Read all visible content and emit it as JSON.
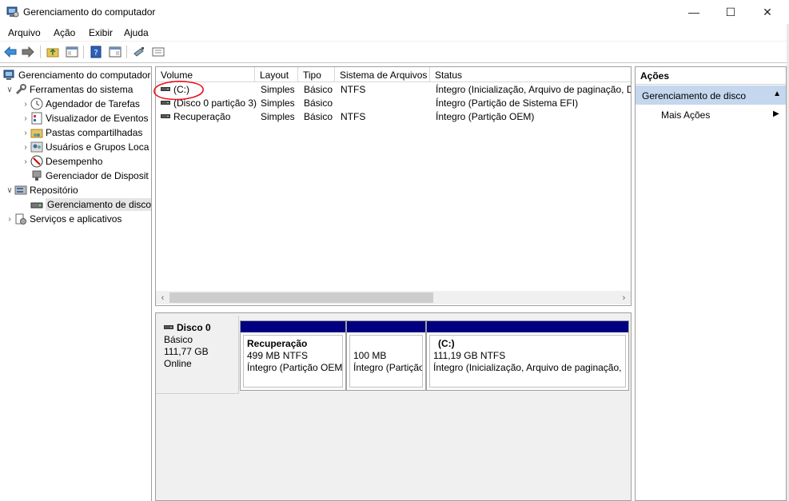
{
  "window": {
    "title": "Gerenciamento do computador",
    "min_glyph": "—",
    "max_glyph": "☐",
    "close_glyph": "✕"
  },
  "menu": [
    "Arquivo",
    "Ação",
    "Exibir",
    "Ajuda"
  ],
  "tree": {
    "root": "Gerenciamento do computador",
    "items": [
      {
        "label": "Ferramentas do sistema",
        "icon": "tools-icon"
      },
      {
        "label": "Agendador de Tarefas",
        "icon": "clock-icon"
      },
      {
        "label": "Visualizador de Eventos",
        "icon": "event-viewer-icon"
      },
      {
        "label": "Pastas compartilhadas",
        "icon": "shared-folder-icon"
      },
      {
        "label": "Usuários e Grupos Loca",
        "icon": "users-icon"
      },
      {
        "label": "Desempenho",
        "icon": "performance-icon"
      },
      {
        "label": "Gerenciador de Disposit",
        "icon": "device-manager-icon"
      },
      {
        "label": "Repositório",
        "icon": "storage-icon"
      },
      {
        "label": "Gerenciamento de disco",
        "icon": "disk-icon"
      },
      {
        "label": "Serviços e aplicativos",
        "icon": "services-icon"
      }
    ]
  },
  "volumes": {
    "columns": [
      "Volume",
      "Layout",
      "Tipo",
      "Sistema de Arquivos",
      "Status"
    ],
    "rows": [
      [
        "(C:)",
        "Simples",
        "Básico",
        "NTFS",
        "Íntegro (Inicialização, Arquivo de paginação, D"
      ],
      [
        "(Disco 0 partição 3)",
        "Simples",
        "Básico",
        "",
        "Íntegro (Partição de Sistema EFI)"
      ],
      [
        "Recuperação",
        "Simples",
        "Básico",
        "NTFS",
        "Íntegro (Partição OEM)"
      ]
    ]
  },
  "disk": {
    "name": "Disco 0",
    "type": "Básico",
    "size": "111,77 GB",
    "state": "Online",
    "partitions": [
      {
        "name": "Recuperação",
        "size": "499 MB NTFS",
        "status": "Íntegro (Partição OEM)"
      },
      {
        "name": "",
        "size": "100 MB",
        "status": "Íntegro (Partição"
      },
      {
        "name": "(C:)",
        "size": "111,19 GB NTFS",
        "status": "Íntegro (Inicialização, Arquivo de paginação,"
      }
    ],
    "partition_bar_color": "#000080"
  },
  "actions": {
    "title": "Ações",
    "section": "Gerenciamento de disco",
    "more": "Mais Ações"
  },
  "colors": {
    "selection": "#c4d7ee",
    "annotation": "#e8141c"
  }
}
